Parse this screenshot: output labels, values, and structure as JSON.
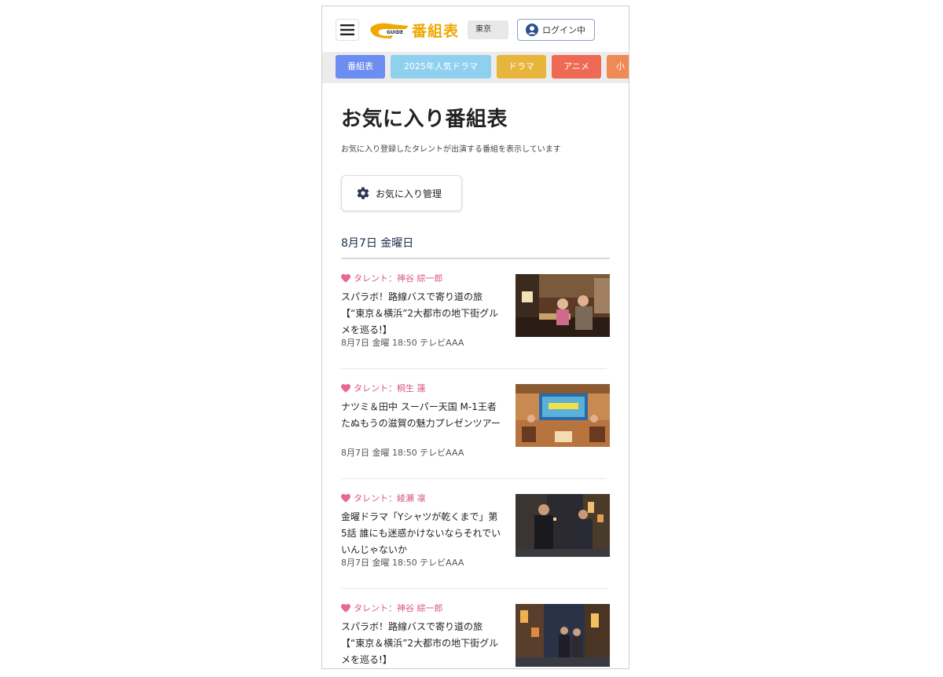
{
  "header": {
    "logo_text": "番組表",
    "region": "東京",
    "login_label": "ログイン中"
  },
  "tabs": [
    {
      "label": "番組表",
      "color": "#6b8ef0"
    },
    {
      "label": "2025年人気ドラマ",
      "color": "#8fd0ef"
    },
    {
      "label": "ドラマ",
      "color": "#e8b53c"
    },
    {
      "label": "アニメ",
      "color": "#ef6a54"
    },
    {
      "label": "小",
      "color": "#f08a55"
    }
  ],
  "page": {
    "title": "お気に入り番組表",
    "description": "お気に入り登録したタレントが出演する番組を表示しています",
    "manage_button": "お気に入り管理",
    "date_heading": "8月7日 金曜日"
  },
  "programs": [
    {
      "talent": "タレント：神谷 綜一郎",
      "title": "スパラボ！路線バスで寄り道の旅 【“東京＆横浜”2大都市の地下街グルメを巡る!】",
      "meta": "8月7日 金曜 18:50 テレビAAA"
    },
    {
      "talent": "タレント：桐生 蓮",
      "title": "ナツミ＆田中 スーパー天国 M-1王者たぬもうの滋賀の魅力プレゼンツアー",
      "meta": "8月7日 金曜 18:50 テレビAAA"
    },
    {
      "talent": "タレント：綾瀬 凛",
      "title": "金曜ドラマ「Yシャツが乾くまで」第5話 誰にも迷惑かけないならそれでいいんじゃないか",
      "meta": "8月7日 金曜 18:50 テレビAAA"
    },
    {
      "talent": "タレント：神谷 綜一郎",
      "title": "スパラボ！路線バスで寄り道の旅 【“東京＆横浜”2大都市の地下街グルメを巡る!】",
      "meta": ""
    }
  ],
  "colors": {
    "accent_pink": "#d9577c",
    "logo_yellow": "#f0a800"
  }
}
